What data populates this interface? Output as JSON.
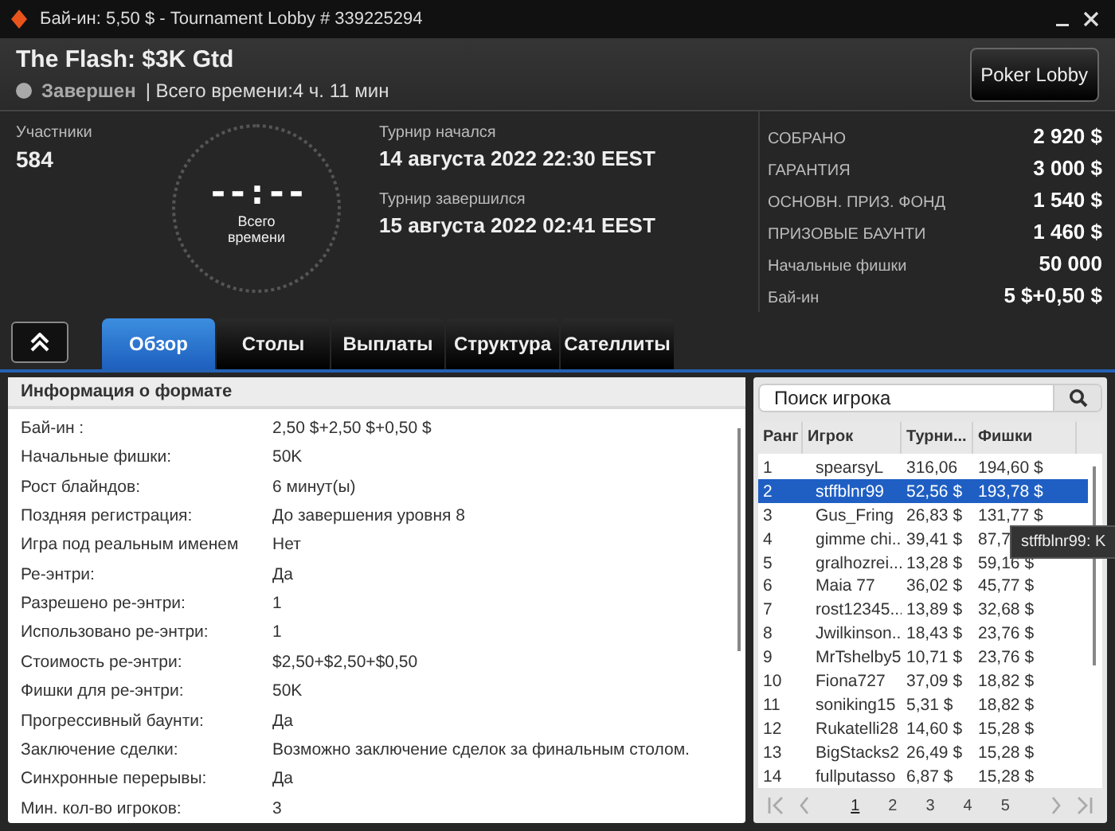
{
  "window": {
    "title": "Бай-ин: 5,50 $ - Tournament Lobby # 339225294"
  },
  "header": {
    "name": "The Flash: $3K Gtd",
    "status": "Завершен",
    "total_time": "| Всего времени:4 ч. 11 мин",
    "lobby_button": "Poker Lobby"
  },
  "info": {
    "participants_label": "Участники",
    "participants": "584",
    "clock": "--:--",
    "clock_caption": "Всего времени",
    "started_label": "Турнир начался",
    "started": "14 августа 2022  22:30 EEST",
    "ended_label": "Турнир завершился",
    "ended": "15 августа 2022  02:41 EEST"
  },
  "stats": [
    {
      "label": "СОБРАНО",
      "value": "2 920 $"
    },
    {
      "label": "ГАРАНТИЯ",
      "value": "3 000 $"
    },
    {
      "label": "ОСНОВН. ПРИЗ. ФОНД",
      "value": "1 540 $"
    },
    {
      "label": "ПРИЗОВЫЕ БАУНТИ",
      "value": "1 460 $"
    },
    {
      "label": "Начальные фишки",
      "value": "50 000"
    },
    {
      "label": "Бай-ин",
      "value": "5 $+0,50 $"
    }
  ],
  "tabs": [
    {
      "label": "Обзор",
      "selected": true
    },
    {
      "label": "Столы",
      "selected": false
    },
    {
      "label": "Выплаты",
      "selected": false
    },
    {
      "label": "Структура",
      "selected": false
    },
    {
      "label": "Сателлиты",
      "selected": false
    }
  ],
  "format": {
    "title": "Информация о формате",
    "rows": [
      {
        "label": "Бай-ин :",
        "value": "2,50 $+2,50 $+0,50 $"
      },
      {
        "label": "Начальные фишки:",
        "value": "50K"
      },
      {
        "label": "Рост блайндов:",
        "value": "6 минут(ы)"
      },
      {
        "label": "Поздняя регистрация:",
        "value": "До завершения уровня 8"
      },
      {
        "label": "Игра под реальным именем",
        "value": "Нет"
      },
      {
        "label": "Ре-энтри:",
        "value": "Да"
      },
      {
        "label": "Разрешено ре-энтри:",
        "value": "1"
      },
      {
        "label": "Использовано ре-энтри:",
        "value": "1"
      },
      {
        "label": "Стоимость ре-энтри:",
        "value": "$2,50+$2,50+$0,50"
      },
      {
        "label": "Фишки для ре-энтри:",
        "value": "50K"
      },
      {
        "label": "Прогрессивный баунти:",
        "value": "Да"
      },
      {
        "label": "Заключение сделки:",
        "value": "Возможно заключение сделок за финальным столом."
      },
      {
        "label": "Синхронные перерывы:",
        "value": "Да"
      },
      {
        "label": "Мин. кол-во игроков:",
        "value": "3"
      }
    ]
  },
  "players": {
    "search_placeholder": "Поиск игрока",
    "columns": [
      "Ранг",
      "Игрок",
      "Турни...",
      "Фишки"
    ],
    "rows": [
      {
        "cells": [
          "1",
          "spearsyL",
          "316,06",
          "194,60 $"
        ],
        "selected": false
      },
      {
        "cells": [
          "2",
          "stffblnr99",
          "52,56 $",
          "193,78 $"
        ],
        "selected": true
      },
      {
        "cells": [
          "3",
          "Gus_Fring",
          "26,83 $",
          "131,77 $"
        ],
        "selected": false
      },
      {
        "cells": [
          "4",
          "gimme chi...",
          "39,41 $",
          "87,7"
        ],
        "selected": false
      },
      {
        "cells": [
          "5",
          "gralhozrei...",
          "13,28 $",
          "59,16 $"
        ],
        "selected": false
      },
      {
        "cells": [
          "6",
          "Maia 77",
          "36,02 $",
          "45,77 $"
        ],
        "selected": false
      },
      {
        "cells": [
          "7",
          "rost12345...",
          "13,89 $",
          "32,68 $"
        ],
        "selected": false
      },
      {
        "cells": [
          "8",
          "Jwilkinson...",
          "18,43 $",
          "23,76 $"
        ],
        "selected": false
      },
      {
        "cells": [
          "9",
          "MrTshelby5",
          "10,71 $",
          "23,76 $"
        ],
        "selected": false
      },
      {
        "cells": [
          "10",
          "Fiona727",
          "37,09 $",
          "18,82 $"
        ],
        "selected": false
      },
      {
        "cells": [
          "11",
          "soniking15",
          "5,31 $",
          "18,82 $"
        ],
        "selected": false
      },
      {
        "cells": [
          "12",
          "Rukatelli28",
          "14,60 $",
          "15,28 $"
        ],
        "selected": false
      },
      {
        "cells": [
          "13",
          "BigStacks2",
          "26,49 $",
          "15,28 $"
        ],
        "selected": false
      },
      {
        "cells": [
          "14",
          "fullputasso",
          "6,87 $",
          "15,28 $"
        ],
        "selected": false
      }
    ],
    "tooltip": "stffblnr99: K",
    "pages": [
      {
        "label": "1",
        "selected": true
      },
      {
        "label": "2",
        "selected": false
      },
      {
        "label": "3",
        "selected": false
      },
      {
        "label": "4",
        "selected": false
      },
      {
        "label": "5",
        "selected": false
      }
    ]
  }
}
